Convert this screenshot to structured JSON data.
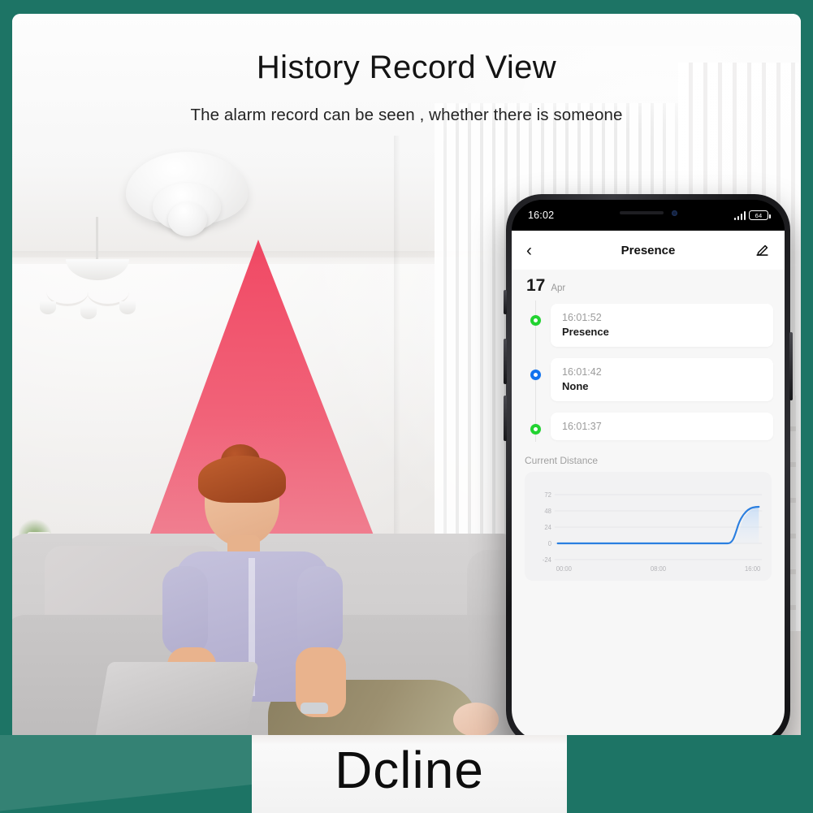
{
  "poster": {
    "headline": "History Record View",
    "subheadline": "The alarm record can be seen , whether there is someone",
    "brand": "Dcline",
    "frame_color": "#1d7465",
    "accent_red": "#ef304f"
  },
  "phone": {
    "statusbar": {
      "time": "16:02",
      "battery_level": "64",
      "signal_icon": "signal-bars-icon",
      "battery_icon": "battery-icon",
      "camera_icon": "front-camera-icon"
    },
    "appbar": {
      "back_icon": "chevron-left-icon",
      "title": "Presence",
      "edit_icon": "pencil-edit-icon"
    },
    "date": {
      "day": "17",
      "month": "Apr"
    },
    "records": [
      {
        "time": "16:01:52",
        "status": "Presence",
        "dot_color": "#22d331",
        "dot_name": "status-dot-green"
      },
      {
        "time": "16:01:42",
        "status": "None",
        "dot_color": "#1273ee",
        "dot_name": "status-dot-blue"
      },
      {
        "time": "16:01:37",
        "status": "",
        "dot_color": "#22d331",
        "dot_name": "status-dot-green"
      }
    ],
    "chart_section_title": "Current Distance"
  },
  "chart_data": {
    "type": "line",
    "title": "Current Distance",
    "xlabel": "",
    "ylabel": "",
    "line_color": "#2b7fe0",
    "fill_color": "#cfe2f8",
    "grid": true,
    "legend": "none",
    "ylim": [
      -24,
      80
    ],
    "yticks": [
      72,
      48,
      24,
      0,
      -24
    ],
    "ytick_labels": [
      "72",
      "48",
      "24",
      "0",
      "-24"
    ],
    "xlim": [
      "00:00",
      "16:00"
    ],
    "xticks": [
      "00:00",
      "08:00",
      "16:00"
    ],
    "x": [
      "00:00",
      "02:00",
      "04:00",
      "06:00",
      "08:00",
      "10:00",
      "12:00",
      "13:00",
      "13:30",
      "14:00",
      "14:30",
      "15:00",
      "15:30",
      "16:00"
    ],
    "values": [
      0,
      0,
      0,
      0,
      0,
      0,
      0,
      0,
      1,
      6,
      26,
      44,
      51,
      53
    ]
  }
}
